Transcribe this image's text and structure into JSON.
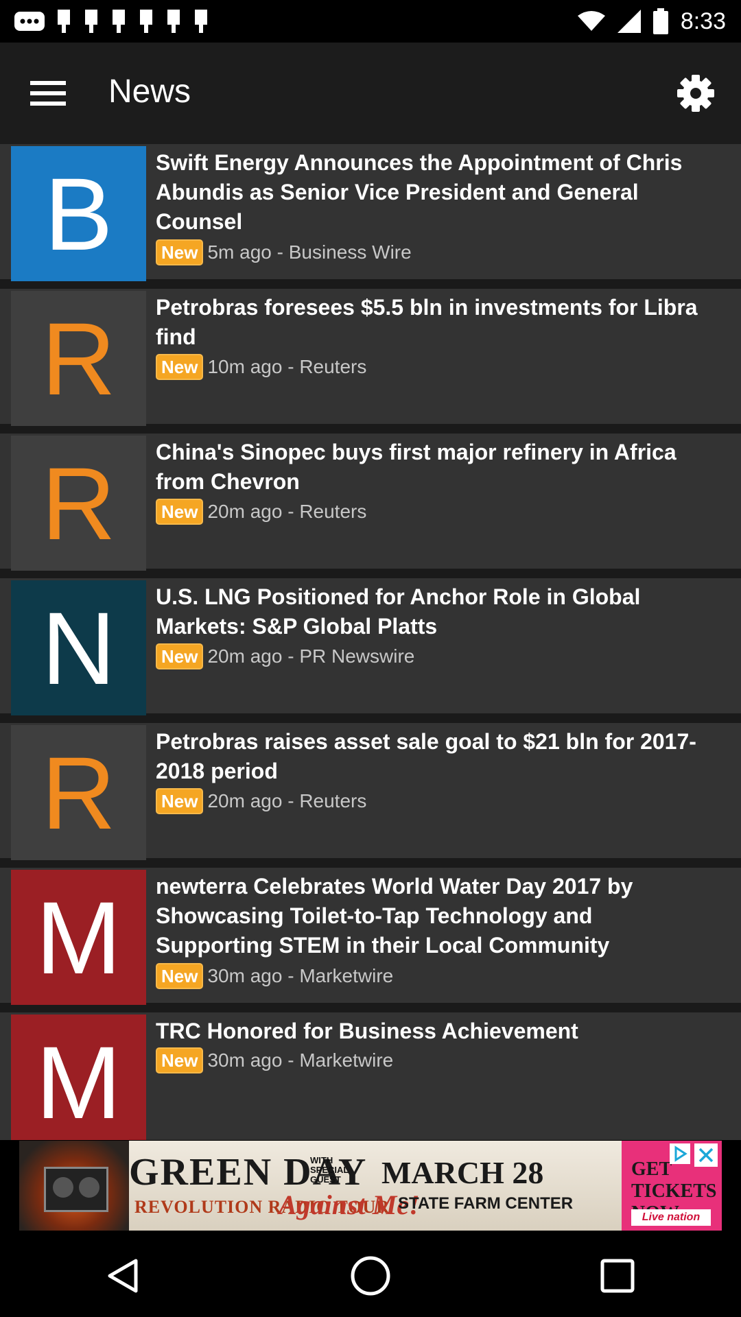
{
  "status_bar": {
    "time": "8:33",
    "icons": [
      "messages-icon",
      "notification-icon",
      "notification-icon",
      "notification-icon",
      "notification-icon",
      "notification-icon",
      "notification-icon",
      "wifi-icon",
      "signal-icon",
      "battery-icon"
    ]
  },
  "app_bar": {
    "title": "News",
    "menu_icon": "hamburger-menu-icon",
    "settings_icon": "gear-icon"
  },
  "news_items": [
    {
      "source_letter": "B",
      "tile_color": "#1b7bc4",
      "letter_color": "#ffffff",
      "title": "Swift Energy Announces the Appointment of Chris Abundis as Senior Vice President and General Counsel",
      "badge": "New",
      "meta": "5m ago - Business Wire"
    },
    {
      "source_letter": "R",
      "tile_color": "#3f3f3f",
      "letter_color": "#f08a1f",
      "title": "Petrobras foresees $5.5 bln in investments for Libra find",
      "badge": "New",
      "meta": "10m ago - Reuters"
    },
    {
      "source_letter": "R",
      "tile_color": "#3f3f3f",
      "letter_color": "#f08a1f",
      "title": "China's Sinopec buys first major refinery in Africa from Chevron",
      "badge": "New",
      "meta": "20m ago - Reuters"
    },
    {
      "source_letter": "N",
      "tile_color": "#0d3a4a",
      "letter_color": "#ffffff",
      "title": "U.S. LNG Positioned for Anchor Role in Global Markets: S&P Global Platts",
      "badge": "New",
      "meta": "20m ago - PR Newswire"
    },
    {
      "source_letter": "R",
      "tile_color": "#3f3f3f",
      "letter_color": "#f08a1f",
      "title": "Petrobras raises asset sale goal to $21 bln for 2017-2018 period",
      "badge": "New",
      "meta": "20m ago - Reuters"
    },
    {
      "source_letter": "M",
      "tile_color": "#9b1f24",
      "letter_color": "#ffffff",
      "title": "newterra Celebrates World Water Day 2017 by Showcasing Toilet-to-Tap Technology and Supporting STEM in their Local Community",
      "badge": "New",
      "meta": "30m ago - Marketwire"
    },
    {
      "source_letter": "M",
      "tile_color": "#9b1f24",
      "letter_color": "#ffffff",
      "title": "TRC Honored for Business Achievement",
      "badge": "New",
      "meta": "30m ago - Marketwire"
    }
  ],
  "ad": {
    "band": "GREEN DAY",
    "guest_line": "WITH SPECIAL GUEST",
    "tour": "REVOLUTION RADIO TOUR",
    "opener": "Against Me!",
    "date": "MARCH 28",
    "venue": "STATE FARM CENTER",
    "cta": "GET TICKETS NOW",
    "brand": "Live nation"
  },
  "nav_bar": {
    "back_icon": "back-triangle-icon",
    "home_icon": "home-circle-icon",
    "recents_icon": "recents-square-icon"
  }
}
